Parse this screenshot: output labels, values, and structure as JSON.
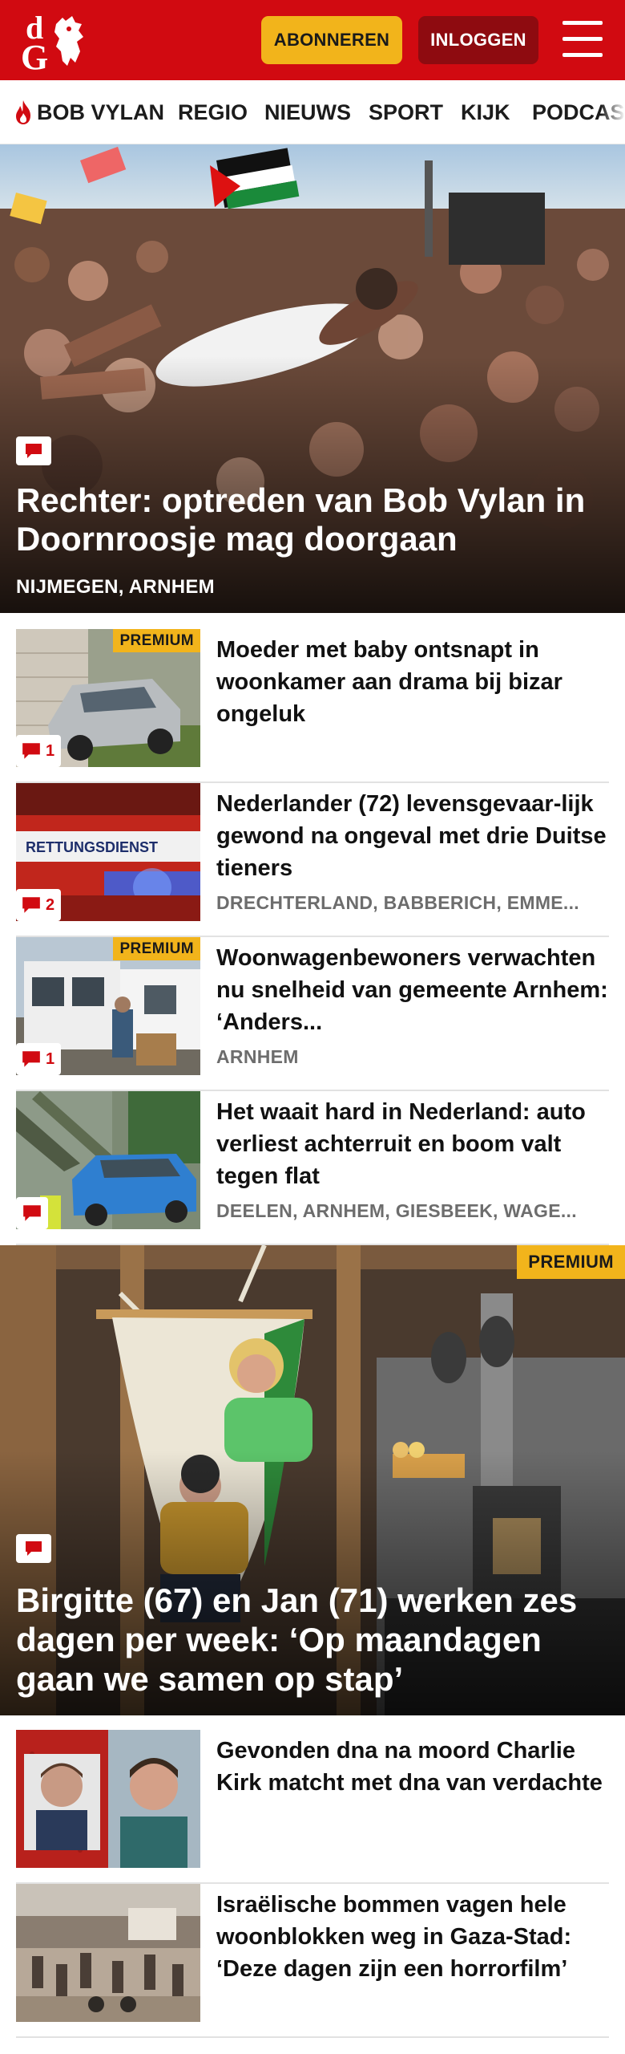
{
  "header": {
    "logo_text": "dG",
    "subscribe_label": "ABONNEREN",
    "login_label": "INLOGGEN",
    "brand_color": "#d10a11",
    "accent_color": "#f2b41b"
  },
  "nav": {
    "items": [
      {
        "label": "BOB VYLAN",
        "icon": "flame-icon"
      },
      {
        "label": "REGIO"
      },
      {
        "label": "NIEUWS"
      },
      {
        "label": "SPORT"
      },
      {
        "label": "KIJK"
      },
      {
        "label": "PODCAS"
      }
    ]
  },
  "hero": {
    "title": "Rechter: optreden van Bob Vylan in Doornroosje mag doorgaan",
    "location": "NIJMEGEN, ARNHEM",
    "icon": "comment-icon"
  },
  "articles": [
    {
      "title": "Moeder met baby ontsnapt in woonkamer aan drama bij bizar ongeluk",
      "location": "",
      "premium": "PREMIUM",
      "comments": "1"
    },
    {
      "title": "Nederlander (72) levensgevaar-lijk gewond na ongeval met drie Duitse tieners",
      "location": "DRECHTERLAND, BABBERICH, EMME...",
      "premium": "",
      "comments": "2",
      "thumb_text": "RETTUNGSDIENST"
    },
    {
      "title": "Woonwagenbewoners verwachten nu snelheid van gemeente Arnhem: ‘Anders...",
      "location": "ARNHEM",
      "premium": "PREMIUM",
      "comments": "1"
    },
    {
      "title": "Het waait hard in Nederland: auto verliest achterruit en boom valt tegen flat",
      "location": "DEELEN, ARNHEM, GIESBEEK, WAGE...",
      "premium": "",
      "comments": ""
    }
  ],
  "feature": {
    "title": "Birgitte (67) en Jan (71) werken zes dagen per week: ‘Op maandagen gaan we samen op stap’",
    "premium": "PREMIUM"
  },
  "more_articles": [
    {
      "title": "Gevonden dna na moord Charlie Kirk matcht met dna van verdachte"
    },
    {
      "title": "Israëlische bommen vagen hele woonblokken weg in Gaza-Stad: ‘Deze dagen zijn een horrorfilm’"
    }
  ]
}
